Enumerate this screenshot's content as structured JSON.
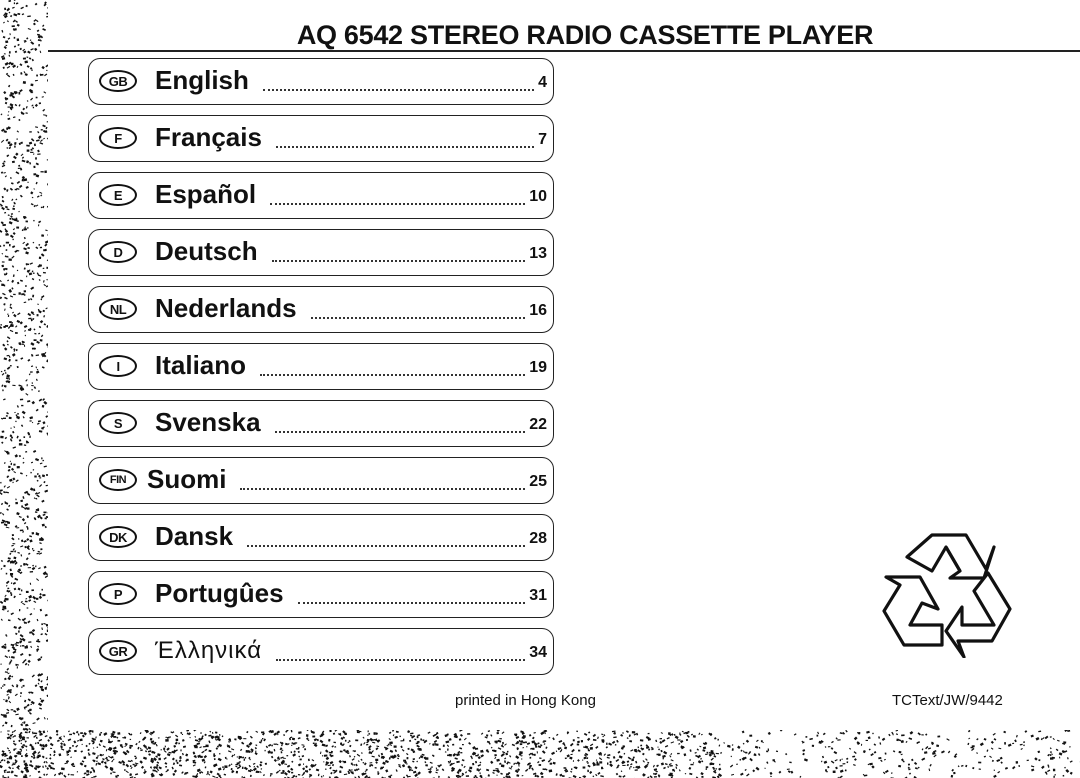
{
  "title": "AQ 6542 STEREO RADIO CASSETTE PLAYER",
  "toc": [
    {
      "code": "GB",
      "language": "English",
      "page": "4"
    },
    {
      "code": "F",
      "language": "Français",
      "page": "7"
    },
    {
      "code": "E",
      "language": "Español",
      "page": "10"
    },
    {
      "code": "D",
      "language": "Deutsch",
      "page": "13"
    },
    {
      "code": "NL",
      "language": "Nederlands",
      "page": "16"
    },
    {
      "code": "I",
      "language": "Italiano",
      "page": "19"
    },
    {
      "code": "S",
      "language": "Svenska",
      "page": "22"
    },
    {
      "code": "FIN",
      "language": "Suomi",
      "page": "25"
    },
    {
      "code": "DK",
      "language": "Dansk",
      "page": "28"
    },
    {
      "code": "P",
      "language": "Portugûes",
      "page": "31"
    },
    {
      "code": "GR",
      "language": "Έλληνικά",
      "page": "34"
    }
  ],
  "footer": {
    "printed_in": "printed in Hong Kong",
    "document_code": "TCText/JW/9442"
  },
  "icons": {
    "recycle": "recycle-icon"
  },
  "colors": {
    "ink": "#111111",
    "paper": "#ffffff"
  }
}
